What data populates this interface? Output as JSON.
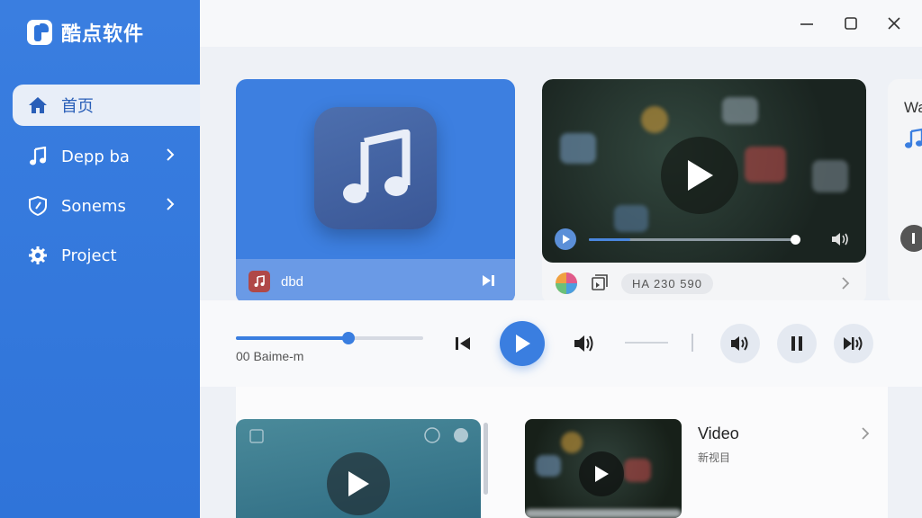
{
  "app": {
    "title": "酷点软件"
  },
  "sidebar": {
    "items": [
      {
        "label": "首页",
        "icon": "home-icon",
        "active": true
      },
      {
        "label": "Depp ba",
        "icon": "music-note-icon",
        "has_submenu": true
      },
      {
        "label": "Sonems",
        "icon": "shield-icon",
        "has_submenu": true
      },
      {
        "label": "Project",
        "icon": "gear-icon"
      }
    ]
  },
  "cards": {
    "music": {
      "label": "dbd"
    },
    "video": {
      "meta_pill": "HA 230 590",
      "progress": 0.1
    },
    "peek": {
      "label": "Wa"
    }
  },
  "player": {
    "time": "00 Baime-m",
    "progress": 0.6
  },
  "list": {
    "item_title": "Video",
    "item_subtitle": "新视目"
  },
  "colors": {
    "accent": "#3a7ee0",
    "sidebar": "#2f74d9"
  }
}
